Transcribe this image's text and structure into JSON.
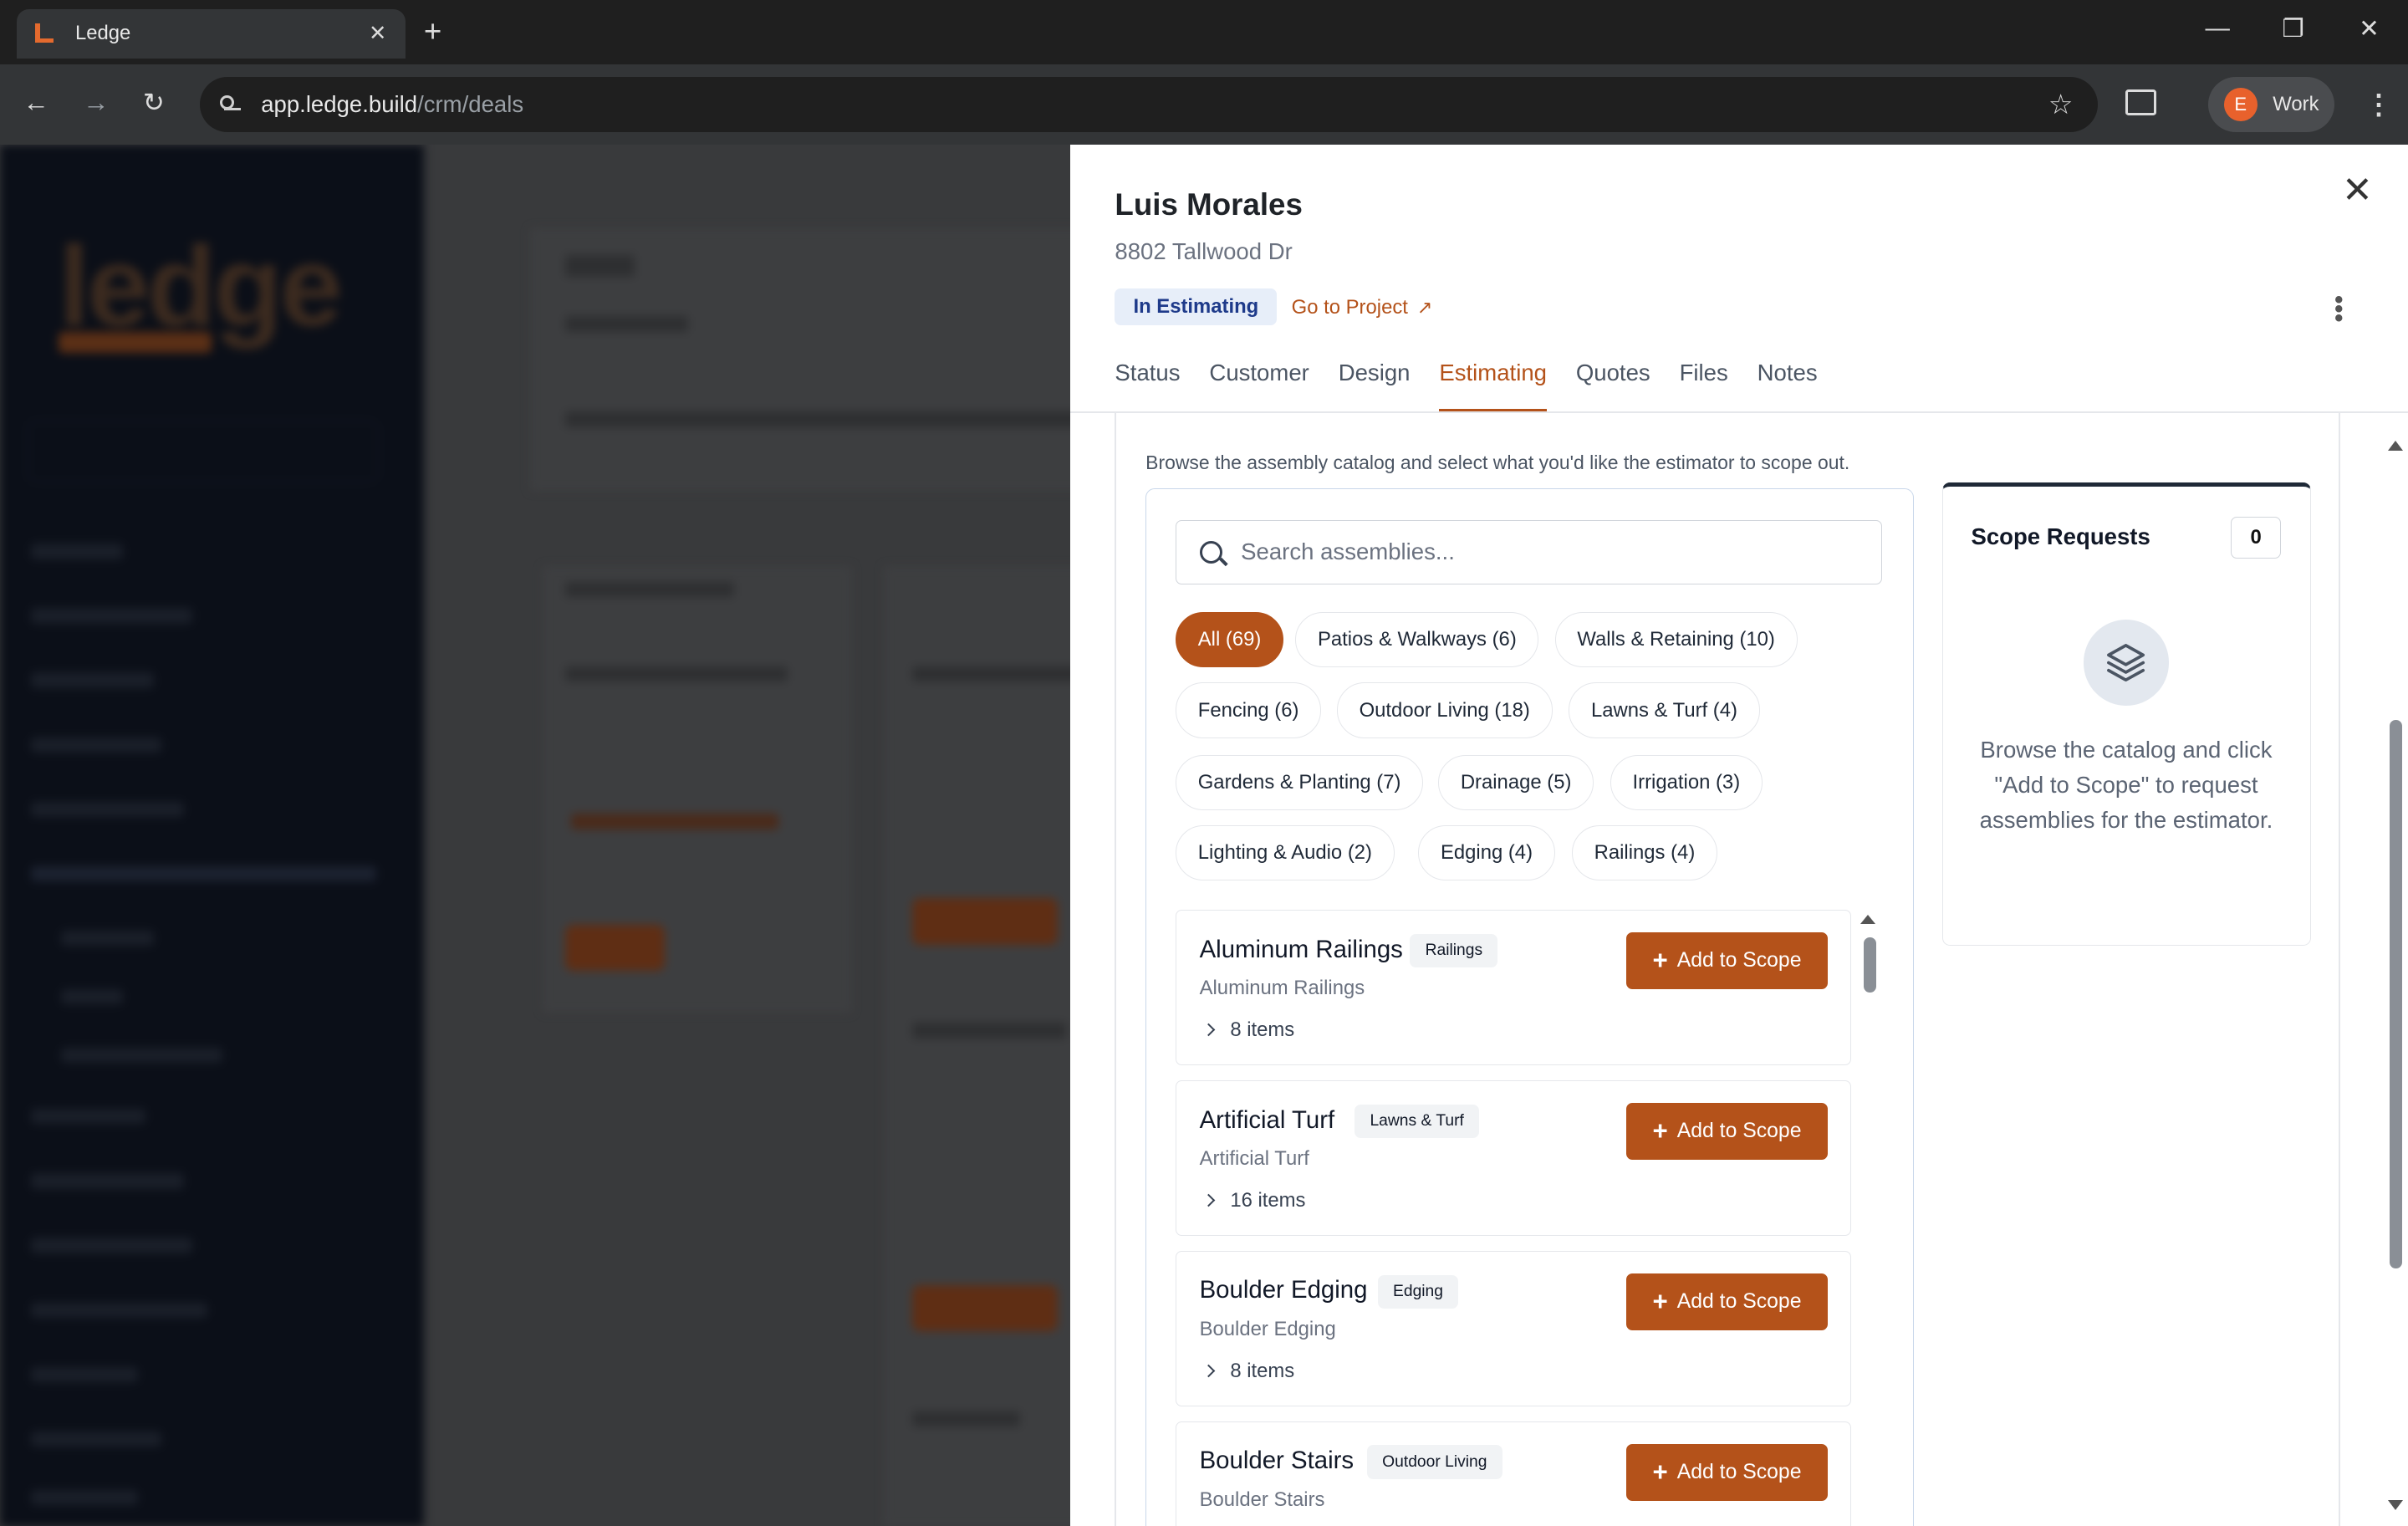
{
  "browser": {
    "tab_title": "Ledge",
    "tab_close": "✕",
    "new_tab": "+",
    "url_host": "app.ledge.build",
    "url_path": "/crm/deals",
    "profile_initial": "E",
    "profile_name": "Work",
    "accent_color": "#e8612c"
  },
  "background_app": {
    "logo_text": "ledge"
  },
  "panel": {
    "contact_name": "Luis Morales",
    "address": "8802 Tallwood Dr",
    "status_badge": "In Estimating",
    "go_to_project": "Go to Project",
    "tabs": [
      {
        "label": "Status"
      },
      {
        "label": "Customer"
      },
      {
        "label": "Design"
      },
      {
        "label": "Estimating"
      },
      {
        "label": "Quotes"
      },
      {
        "label": "Files"
      },
      {
        "label": "Notes"
      }
    ],
    "active_tab": "Estimating",
    "accent_color": "#b4521a"
  },
  "estimating": {
    "description": "Browse the assembly catalog and select what you'd like the estimator to scope out.",
    "search_placeholder": "Search assemblies...",
    "search_value": "",
    "filters": [
      {
        "label": "All (69)"
      },
      {
        "label": "Patios & Walkways (6)"
      },
      {
        "label": "Walls & Retaining (10)"
      },
      {
        "label": "Fencing (6)"
      },
      {
        "label": "Outdoor Living (18)"
      },
      {
        "label": "Lawns & Turf (4)"
      },
      {
        "label": "Gardens & Planting (7)"
      },
      {
        "label": "Drainage (5)"
      },
      {
        "label": "Irrigation (3)"
      },
      {
        "label": "Lighting & Audio (2)"
      },
      {
        "label": "Edging (4)"
      },
      {
        "label": "Railings (4)"
      }
    ],
    "active_filter": "All (69)",
    "add_label": "Add to Scope",
    "assemblies": [
      {
        "name": "Aluminum Railings",
        "tag": "Railings",
        "sub": "Aluminum Railings",
        "count": "8 items"
      },
      {
        "name": "Artificial Turf",
        "tag": "Lawns & Turf",
        "sub": "Artificial Turf",
        "count": "16 items"
      },
      {
        "name": "Boulder Edging",
        "tag": "Edging",
        "sub": "Boulder Edging",
        "count": "8 items"
      },
      {
        "name": "Boulder Stairs",
        "tag": "Outdoor Living",
        "sub": "Boulder Stairs",
        "count": ""
      }
    ]
  },
  "scope": {
    "title": "Scope Requests",
    "count": "0",
    "empty_text": "Browse the catalog and click \"Add to Scope\" to request assemblies for the estimator."
  }
}
